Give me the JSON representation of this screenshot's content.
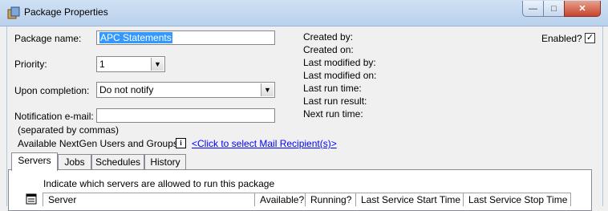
{
  "window": {
    "title": "Package Properties",
    "buttons": {
      "minimize": "—",
      "maximize": "□",
      "close": "✕"
    }
  },
  "form": {
    "package_name_label": "Package name:",
    "package_name_value": "APC Statements",
    "priority_label": "Priority:",
    "priority_value": "1",
    "completion_label": "Upon completion:",
    "completion_value": "Do not notify",
    "email_label": "Notification e-mail:",
    "email_value": "",
    "email_hint": "(separated by commas)",
    "users_label": "Available NextGen Users and Groups:",
    "users_link": "<Click to select Mail Recipient(s)>",
    "enabled_label": "Enabled?",
    "enabled_checked": "✓"
  },
  "info": {
    "created_by": "Created by:",
    "created_on": "Created on:",
    "last_modified_by": "Last modified by:",
    "last_modified_on": "Last modified on:",
    "last_run_time": "Last run time:",
    "last_run_result": "Last run result:",
    "next_run_time": "Next run time:"
  },
  "tabs": [
    {
      "label": "Servers"
    },
    {
      "label": "Jobs"
    },
    {
      "label": "Schedules"
    },
    {
      "label": "History"
    }
  ],
  "servers_tab": {
    "instruction": "Indicate which servers are allowed to run this package",
    "columns": [
      "Server",
      "Available?",
      "Running?",
      "Last Service Start Time",
      "Last Service Stop Time"
    ]
  }
}
